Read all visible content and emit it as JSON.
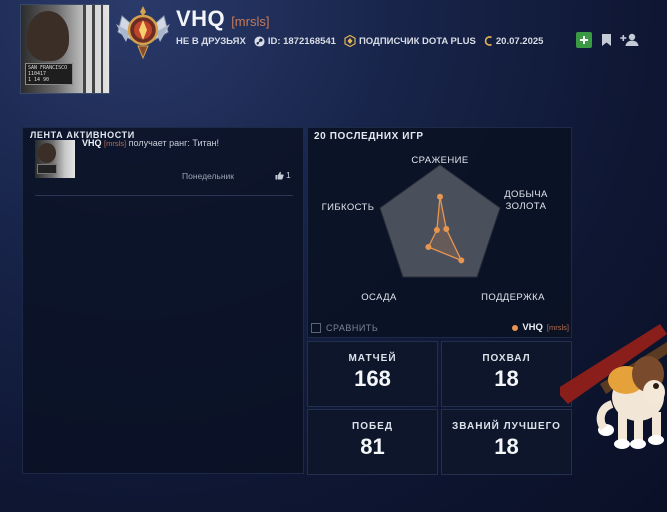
{
  "header": {
    "player_name": "VHQ",
    "clan_tag": "[mrsls]",
    "friend_status": "НЕ В ДРУЗЬЯХ",
    "id_text": "ID: 1872168541",
    "plus_text": "ПОДПИСЧИК DOTA PLUS",
    "plus_date": "20.07.2025",
    "avatar_plate": [
      "SAN FRANCISCO",
      "110417",
      "1 14 90"
    ]
  },
  "feed": {
    "title": "ЛЕНТА АКТИВНОСТИ",
    "items": [
      {
        "name": "VHQ",
        "tag": "[mrsls]",
        "text": "получает ранг: Титан!",
        "day": "Понедельник",
        "likes": "1"
      }
    ]
  },
  "games": {
    "title": "20 ПОСЛЕДНИХ ИГР",
    "axes": [
      "СРАЖЕНИЕ",
      "ДОБЫЧА ЗОЛОТА",
      "ПОДДЕРЖКА",
      "ОСАДА",
      "ГИБКОСТЬ"
    ],
    "axis_lines": {
      "fight": "СРАЖЕНИЕ",
      "farm_1": "ДОБЫЧА",
      "farm_2": "ЗОЛОТА",
      "support": "ПОДДЕРЖКА",
      "push": "ОСАДА",
      "versatility": "ГИБКОСТЬ"
    },
    "values": [
      0.52,
      0.1,
      0.55,
      0.3,
      0.05
    ],
    "series_color": "#e8954f",
    "compare_label": "СРАВНИТЬ",
    "legend_name": "VHQ",
    "legend_tag": "[mrsls]"
  },
  "stats": [
    {
      "label": "МАТЧЕЙ",
      "value": "168"
    },
    {
      "label": "ПОХВАЛ",
      "value": "18"
    },
    {
      "label": "ПОБЕД",
      "value": "81"
    },
    {
      "label": "ЗВАНИЙ ЛУЧШЕГО",
      "value": "18"
    }
  ],
  "icons": {
    "add_friend": "plus-icon",
    "bookmark": "bookmark-icon",
    "invite": "add-user-icon",
    "steam": "steam-icon",
    "dota_plus": "dota-plus-icon",
    "shard": "shard-icon",
    "like": "thumbs-up-icon"
  },
  "colors": {
    "accent": "#e8954f",
    "clan_tag": "#c57a5a",
    "add_button": "#3a9a44"
  }
}
